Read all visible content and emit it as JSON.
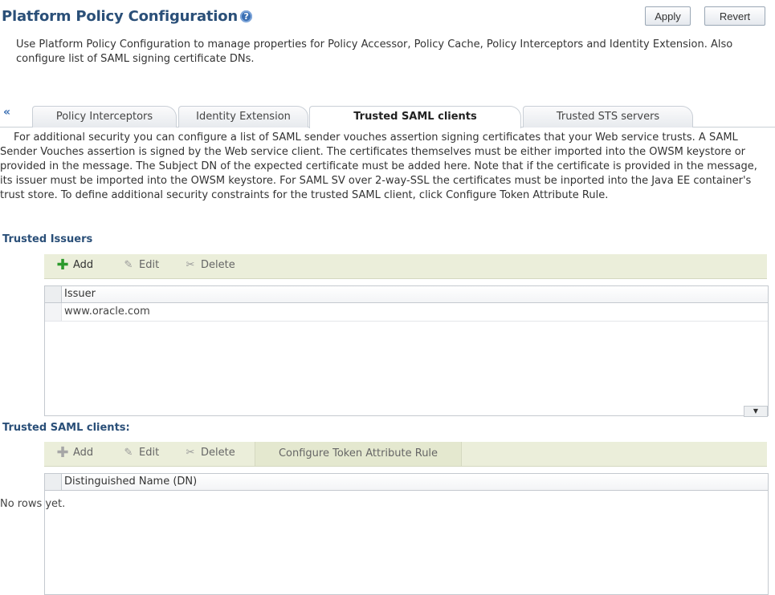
{
  "header": {
    "title": "Platform Policy Configuration",
    "help_glyph": "?",
    "apply_label": "Apply",
    "revert_label": "Revert"
  },
  "intro": "Use Platform Policy Configuration to manage properties for Policy Accessor, Policy Cache, Policy Interceptors and Identity Extension. Also configure list of SAML signing certificate DNs.",
  "tabs": {
    "scroll_glyph": "«",
    "items": [
      {
        "label": "Policy Interceptors",
        "active": false
      },
      {
        "label": "Identity Extension",
        "active": false
      },
      {
        "label": "Trusted SAML clients",
        "active": true
      },
      {
        "label": "Trusted STS servers",
        "active": false
      }
    ]
  },
  "description": "For additional security you can configure a list of SAML sender vouches assertion signing certificates that your Web service trusts. A SAML Sender Vouches assertion is signed by the Web service client. The certificates themselves must be either imported into the OWSM keystore or provided in the message. The Subject DN of the expected certificate must be added here. Note that if the certificate is provided in the message, its issuer must be imported into the OWSM keystore. For SAML SV over 2-way-SSL the certificates must be inported into the Java EE container's trust store. To define additional security constraints for the trusted SAML client, click Configure Token Attribute Rule.",
  "issuers": {
    "title": "Trusted Issuers",
    "toolbar": {
      "add": "Add",
      "edit": "Edit",
      "delete": "Delete"
    },
    "column": "Issuer",
    "rows": [
      "www.oracle.com"
    ]
  },
  "clients": {
    "title": "Trusted SAML clients:",
    "toolbar": {
      "add": "Add",
      "edit": "Edit",
      "delete": "Delete",
      "configure": "Configure Token Attribute Rule"
    },
    "column": "Distinguished Name (DN)",
    "empty": "No rows yet."
  },
  "icons": {
    "add": "plus-icon",
    "edit": "pencil-icon",
    "delete": "scissors-icon",
    "help": "help-icon"
  }
}
